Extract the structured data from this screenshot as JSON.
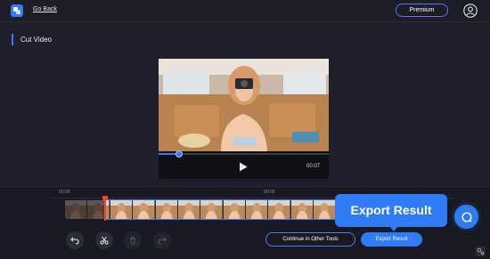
{
  "header": {
    "app_icon": "app-logo-icon",
    "back_label": "Go Back",
    "premium_label": "Premium",
    "avatar_icon": "user-avatar-icon"
  },
  "page": {
    "title": "Cut Video"
  },
  "player": {
    "duration": "00:07",
    "progress": 0.12,
    "play_icon": "play-icon"
  },
  "timeline": {
    "ticks": [
      "00:00",
      "00:05"
    ],
    "playhead_position": 0.13,
    "selection": {
      "start": 0.13,
      "end": 1.0
    }
  },
  "toolbar": {
    "undo_icon": "undo-icon",
    "cut_icon": "scissors-icon",
    "delete_icon": "trash-icon",
    "redo_icon": "redo-icon"
  },
  "actions": {
    "continue_label": "Continue in Other Tools",
    "export_label": "Export Result"
  },
  "tooltip": {
    "label": "Export Result"
  },
  "help": {
    "icon": "chat-help-icon"
  },
  "colors": {
    "accent": "#2f7cf6",
    "background": "#1e1f2a",
    "playhead": "#ff3b3b"
  }
}
